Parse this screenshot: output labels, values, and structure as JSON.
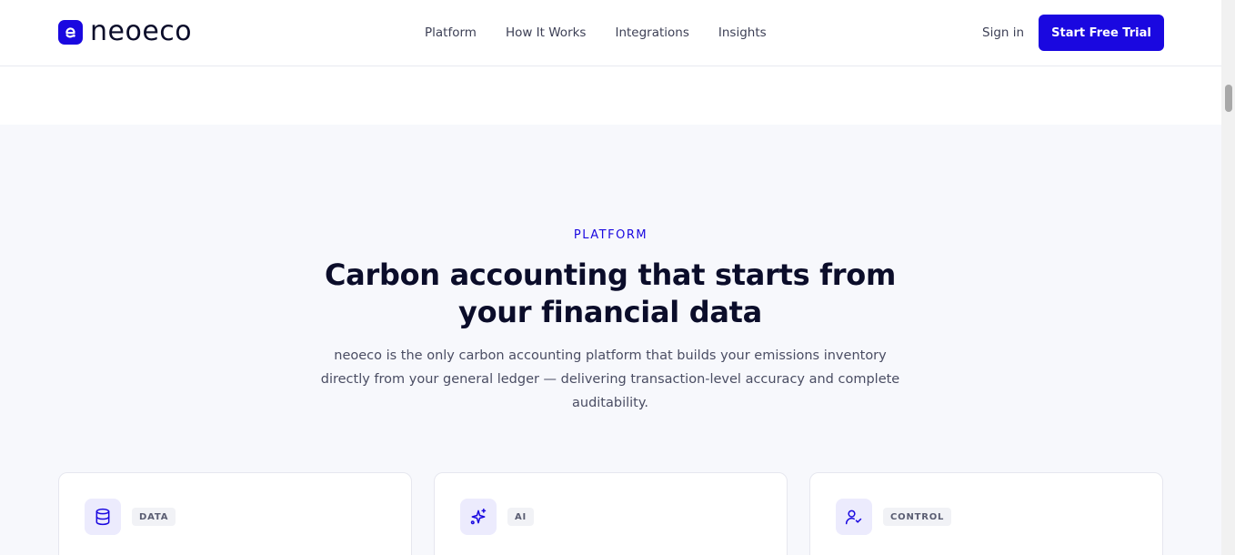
{
  "header": {
    "logo_text": "neoeco",
    "nav": [
      "Platform",
      "How It Works",
      "Integrations",
      "Insights"
    ],
    "signin_label": "Sign in",
    "cta_label": "Start Free Trial"
  },
  "hero": {
    "eyebrow": "PLATFORM",
    "title": "Carbon accounting that starts from your financial data",
    "subtitle": "neoeco is the only carbon accounting platform that builds your emissions inventory directly from your general ledger — delivering transaction-level accuracy and complete auditability."
  },
  "cards": [
    {
      "tag": "DATA",
      "icon": "database-icon"
    },
    {
      "tag": "AI",
      "icon": "sparkles-icon"
    },
    {
      "tag": "CONTROL",
      "icon": "user-check-icon"
    }
  ],
  "colors": {
    "accent": "#1a08e0",
    "background": "#f7f8fc",
    "text": "#0b0d2a"
  }
}
